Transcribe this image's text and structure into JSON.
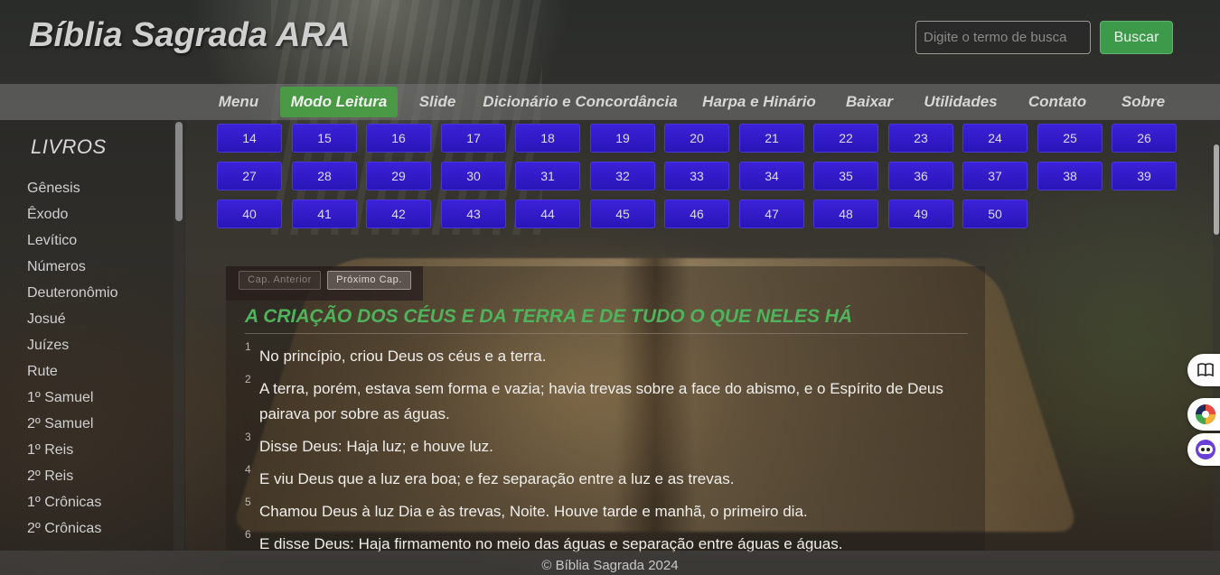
{
  "header": {
    "site_title": "Bíblia Sagrada ARA",
    "search_placeholder": "Digite o termo de busca",
    "search_button": "Buscar"
  },
  "nav": {
    "items": [
      "Menu",
      "Modo Leitura",
      "Slide",
      "Dicionário e Concordância",
      "Harpa e Hinário",
      "Baixar",
      "Utilidades",
      "Contato",
      "Sobre"
    ],
    "active": "Modo Leitura"
  },
  "sidebar": {
    "title": "LIVROS",
    "books": [
      "Gênesis",
      "Êxodo",
      "Levítico",
      "Números",
      "Deuteronômio",
      "Josué",
      "Juízes",
      "Rute",
      "1º Samuel",
      "2º Samuel",
      "1º Reis",
      "2º Reis",
      "1º Crônicas",
      "2º Crônicas"
    ]
  },
  "chapters": [
    "14",
    "15",
    "16",
    "17",
    "18",
    "19",
    "20",
    "21",
    "22",
    "23",
    "24",
    "25",
    "26",
    "27",
    "28",
    "29",
    "30",
    "31",
    "32",
    "33",
    "34",
    "35",
    "36",
    "37",
    "38",
    "39",
    "40",
    "41",
    "42",
    "43",
    "44",
    "45",
    "46",
    "47",
    "48",
    "49",
    "50"
  ],
  "reader": {
    "prev_label": "Cap. Anterior",
    "next_label": "Próximo Cap.",
    "heading": "A CRIAÇÃO DOS CÉUS E DA TERRA E DE TUDO O QUE NELES HÁ",
    "verses": [
      {
        "num": "1",
        "text": "No princípio, criou Deus os céus e a terra."
      },
      {
        "num": "2",
        "text": "A terra, porém, estava sem forma e vazia; havia trevas sobre a face do abismo, e o Espírito de Deus pairava por sobre as águas."
      },
      {
        "num": "3",
        "text": "Disse Deus: Haja luz; e houve luz."
      },
      {
        "num": "4",
        "text": "E viu Deus que a luz era boa; e fez separação entre a luz e as trevas."
      },
      {
        "num": "5",
        "text": "Chamou Deus à luz Dia e às trevas, Noite. Houve tarde e manhã, o primeiro dia."
      },
      {
        "num": "6",
        "text": "E disse Deus: Haja firmamento no meio das águas e separação entre águas e águas."
      }
    ]
  },
  "widgets": [
    "book-icon",
    "color-palette-icon",
    "robot-face-icon"
  ],
  "footer": {
    "text": "© Bíblia Sagrada 2024"
  },
  "colors": {
    "accent_green": "#4a9a45",
    "chapter_blue": "#2a15b8",
    "heading_green": "#4fb35c"
  }
}
